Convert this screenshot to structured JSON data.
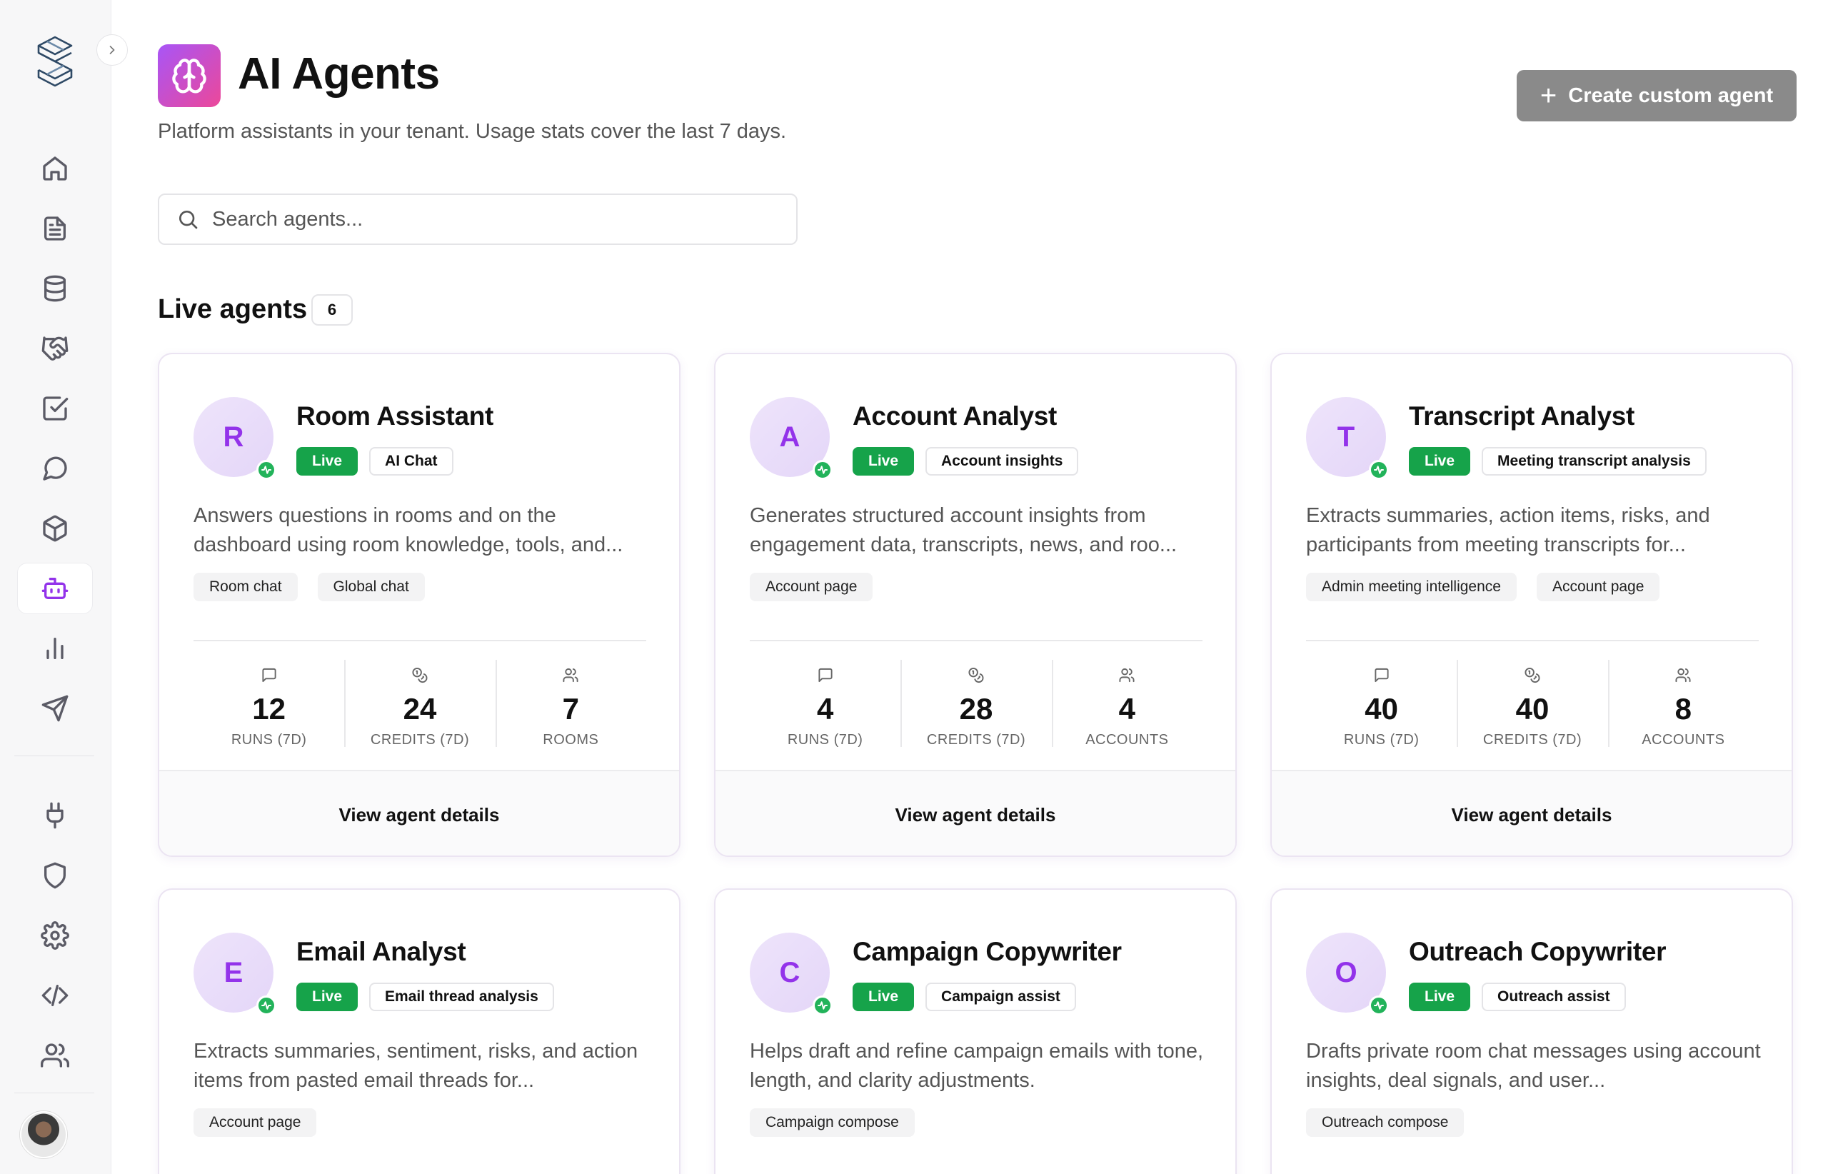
{
  "header": {
    "title": "AI Agents",
    "subtitle": "Platform assistants in your tenant. Usage stats cover the last 7 days.",
    "create_button_label": "Create custom agent"
  },
  "search": {
    "placeholder": "Search agents..."
  },
  "section": {
    "title": "Live agents",
    "count": "6"
  },
  "sidebar": {
    "items": [
      {
        "icon": "home-icon"
      },
      {
        "icon": "document-icon"
      },
      {
        "icon": "database-icon"
      },
      {
        "icon": "handshake-icon"
      },
      {
        "icon": "checkbox-icon"
      },
      {
        "icon": "chat-icon"
      },
      {
        "icon": "package-icon"
      },
      {
        "icon": "bot-icon",
        "active": true
      },
      {
        "icon": "bar-chart-icon"
      },
      {
        "icon": "send-icon"
      },
      {
        "icon": "plug-icon"
      },
      {
        "icon": "shield-icon"
      },
      {
        "icon": "gear-icon"
      },
      {
        "icon": "code-icon"
      },
      {
        "icon": "users-icon"
      }
    ],
    "accent_color": "#9333ea"
  },
  "colors": {
    "live": "#16a34a",
    "accent": "#9333ea",
    "button": "#8a8a8a"
  },
  "agents": [
    {
      "initial": "R",
      "name": "Room Assistant",
      "status": "Live",
      "category": "AI Chat",
      "description": "Answers questions in rooms and on the dashboard using room knowledge, tools, and...",
      "surfaces": [
        "Room chat",
        "Global chat"
      ],
      "stats": [
        {
          "value": "12",
          "label": "RUNS (7D)"
        },
        {
          "value": "24",
          "label": "CREDITS (7D)"
        },
        {
          "value": "7",
          "label": "ROOMS"
        }
      ],
      "details_label": "View agent details"
    },
    {
      "initial": "A",
      "name": "Account Analyst",
      "status": "Live",
      "category": "Account insights",
      "description": "Generates structured account insights from engagement data, transcripts, news, and roo...",
      "surfaces": [
        "Account page"
      ],
      "stats": [
        {
          "value": "4",
          "label": "RUNS (7D)"
        },
        {
          "value": "28",
          "label": "CREDITS (7D)"
        },
        {
          "value": "4",
          "label": "ACCOUNTS"
        }
      ],
      "details_label": "View agent details"
    },
    {
      "initial": "T",
      "name": "Transcript Analyst",
      "status": "Live",
      "category": "Meeting transcript analysis",
      "description": "Extracts summaries, action items, risks, and participants from meeting transcripts for...",
      "surfaces": [
        "Admin meeting intelligence",
        "Account page"
      ],
      "stats": [
        {
          "value": "40",
          "label": "RUNS (7D)"
        },
        {
          "value": "40",
          "label": "CREDITS (7D)"
        },
        {
          "value": "8",
          "label": "ACCOUNTS"
        }
      ],
      "details_label": "View agent details"
    },
    {
      "initial": "E",
      "name": "Email Analyst",
      "status": "Live",
      "category": "Email thread analysis",
      "description": "Extracts summaries, sentiment, risks, and action items from pasted email threads for...",
      "surfaces": [
        "Account page"
      ]
    },
    {
      "initial": "C",
      "name": "Campaign Copywriter",
      "status": "Live",
      "category": "Campaign assist",
      "description": "Helps draft and refine campaign emails with tone, length, and clarity adjustments.",
      "surfaces": [
        "Campaign compose"
      ]
    },
    {
      "initial": "O",
      "name": "Outreach Copywriter",
      "status": "Live",
      "category": "Outreach assist",
      "description": "Drafts private room chat messages using account insights, deal signals, and user...",
      "surfaces": [
        "Outreach compose"
      ]
    }
  ]
}
